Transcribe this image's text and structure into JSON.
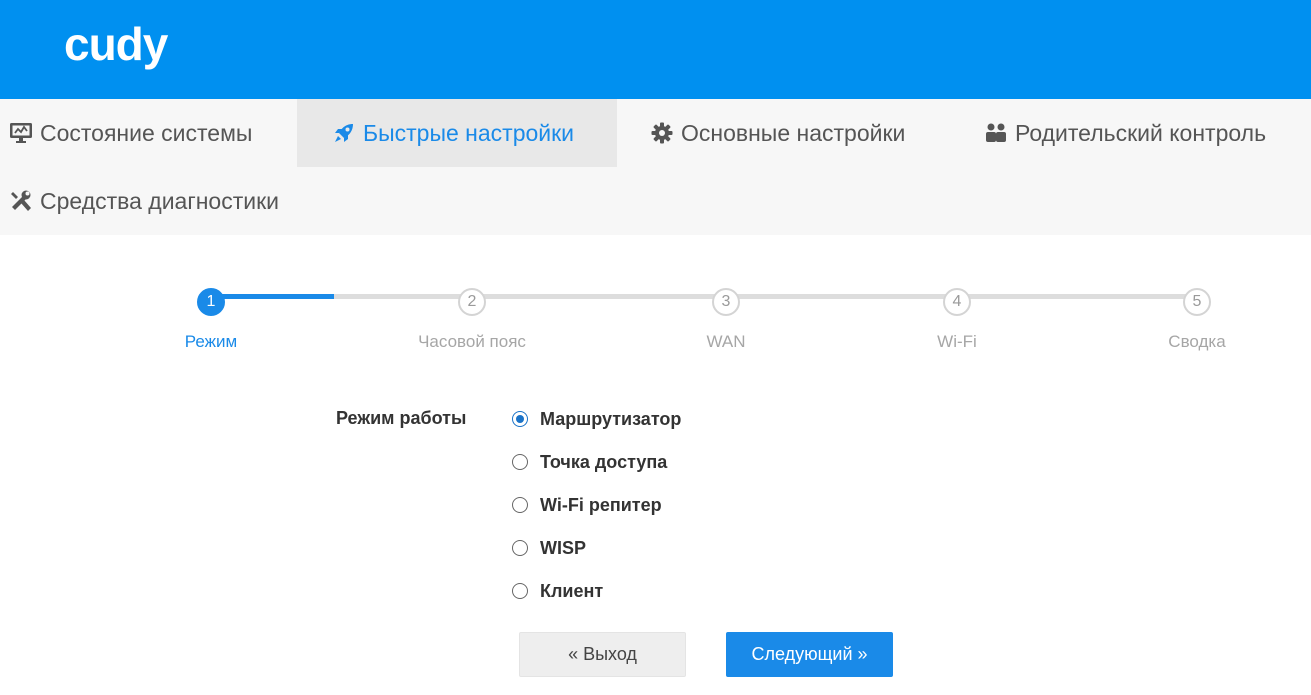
{
  "brand": {
    "logo_text": "cudy",
    "header_color": "#0090f0",
    "accent": "#1a8ae8"
  },
  "nav": {
    "items": [
      {
        "label": "Состояние системы",
        "icon": "monitor-icon",
        "active": false
      },
      {
        "label": "Быстрые настройки",
        "icon": "rocket-icon",
        "active": true
      },
      {
        "label": "Основные настройки",
        "icon": "gear-icon",
        "active": false
      },
      {
        "label": "Родительский контроль",
        "icon": "users-icon",
        "active": false
      },
      {
        "label": "Средства диагностики",
        "icon": "wrench-icon",
        "active": false
      }
    ]
  },
  "wizard": {
    "progress": 0.125,
    "steps": [
      {
        "number": "1",
        "label": "Режим",
        "active": true
      },
      {
        "number": "2",
        "label": "Часовой пояс",
        "active": false
      },
      {
        "number": "3",
        "label": "WAN",
        "active": false
      },
      {
        "number": "4",
        "label": "Wi-Fi",
        "active": false
      },
      {
        "number": "5",
        "label": "Сводка",
        "active": false
      }
    ]
  },
  "mode": {
    "label": "Режим работы",
    "options": [
      {
        "label": "Маршрутизатор",
        "checked": true
      },
      {
        "label": "Точка доступа",
        "checked": false
      },
      {
        "label": "Wi-Fi репитер",
        "checked": false
      },
      {
        "label": "WISP",
        "checked": false
      },
      {
        "label": "Клиент",
        "checked": false
      }
    ]
  },
  "buttons": {
    "exit_label": "« Выход",
    "next_label": "Следующий »"
  }
}
